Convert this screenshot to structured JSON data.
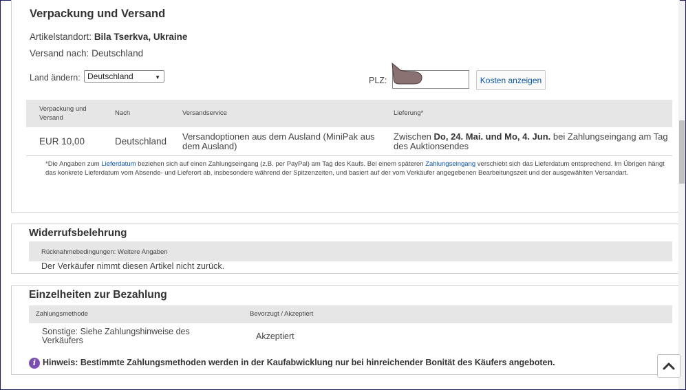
{
  "shipping": {
    "title": "Verpackung und Versand",
    "location_label": "Artikelstandort:",
    "location_value": "Bila Tserkva, Ukraine",
    "ship_to": "Versand nach: Deutschland",
    "change_country_label": "Land ändern:",
    "country_selected": "Deutschland",
    "plz_label": "PLZ:",
    "plz_value": "",
    "calc_button": "Kosten anzeigen",
    "columns": [
      "Verpackung und Versand",
      "Nach",
      "Versandservice",
      "Lieferung*"
    ],
    "row": {
      "cost": "EUR 10,00",
      "to": "Deutschland",
      "service": "Versandoptionen aus dem Ausland (MiniPak aus dem Ausland)",
      "delivery_prefix": "Zwischen",
      "delivery_bold": "Do, 24. Mai. und Mo, 4. Jun.",
      "delivery_suffix": "bei Zahlungseingang am Tag des Auktionsendes"
    },
    "footnote": {
      "part1": "*Die Angaben zum",
      "link1": "Lieferdatum",
      "part2": "beziehen sich auf einen Zahlungseingang (z.B. per PayPal) am Tag des Kaufs. Bei einem späteren",
      "link2": "Zahlungseingang",
      "part3": "verschiebt sich das Lieferdatum entsprechend. Im Übrigen hängt das konkrete Lieferdatum vom Absende- und Lieferort ab, insbesondere während der Spitzenzeiten, und basiert auf der vom Verkäufer angegebenen Bearbeitungszeit und der ausgewählten Versandart."
    }
  },
  "returns": {
    "title": "Widerrufsbelehrung",
    "header": "Rücknahmebedingungen: Weitere Angaben",
    "text": "Der Verkäufer nimmt diesen Artikel nicht zurück."
  },
  "payment": {
    "title": "Einzelheiten zur Bezahlung",
    "columns": [
      "Zahlungsmethode",
      "Bevorzugt / Akzeptiert"
    ],
    "method": "Sonstige: Siehe Zahlungshinweise des Verkäufers",
    "status": "Akzeptiert",
    "note": "Hinweis: Bestimmte Zahlungsmethoden werden in der Kaufabwicklung nur bei hinreichender Bonität des Käufers angeboten."
  },
  "colors": {
    "link": "#0654ba",
    "info_icon": "#7b4fb6",
    "header_bg": "#e6e6e6"
  },
  "icons": [
    "dropdown-arrow-icon",
    "pointer-cursor-icon",
    "info-icon",
    "chevron-up-icon"
  ]
}
